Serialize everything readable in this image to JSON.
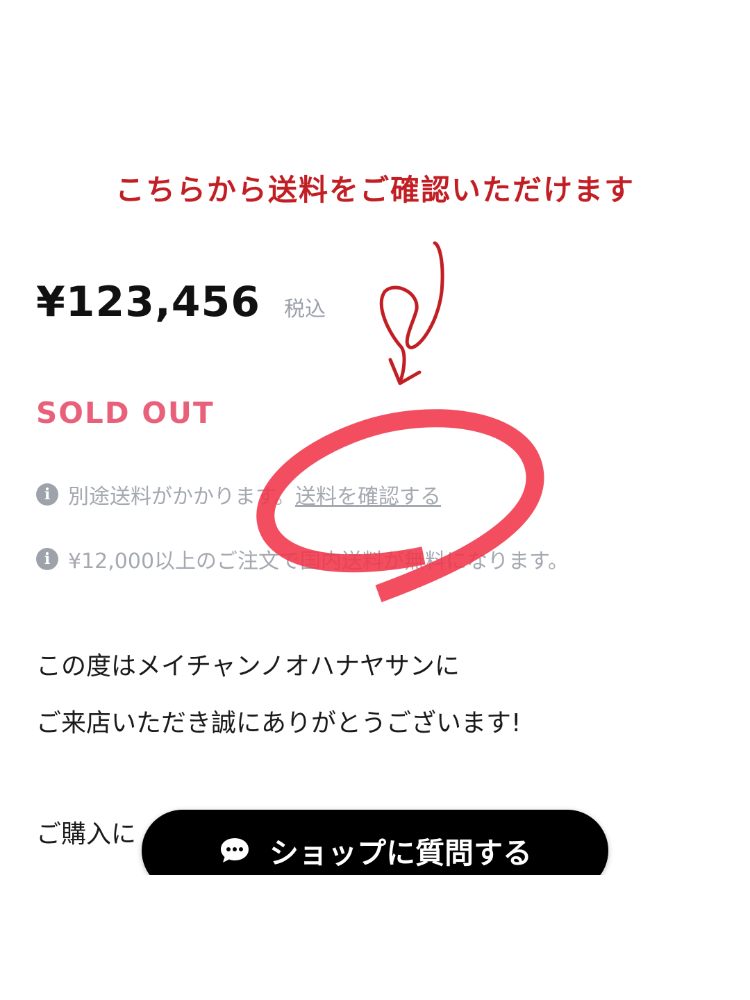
{
  "annotation": {
    "title": "こちらから送料をご確認いただけます",
    "color": "#c21f24",
    "circle_color": "#f0364a"
  },
  "product": {
    "price": "¥123,456",
    "tax_label": "税込",
    "status": "SOLD OUT",
    "status_color": "#e8607a"
  },
  "shipping": {
    "info_icon": "info-icon",
    "note_text": "別途送料がかかります。",
    "link_text": "送料を確認する",
    "free_text": "¥12,000以上のご注文で国内送料が無料になります。"
  },
  "description": {
    "line1": "この度はメイチャンノオハナヤサンに",
    "line2": "ご来店いただき誠にありがとうございます!",
    "line3": "ご購入に"
  },
  "chat_button": {
    "icon": "chat-bubble-icon",
    "label": "ショップに質問する"
  }
}
